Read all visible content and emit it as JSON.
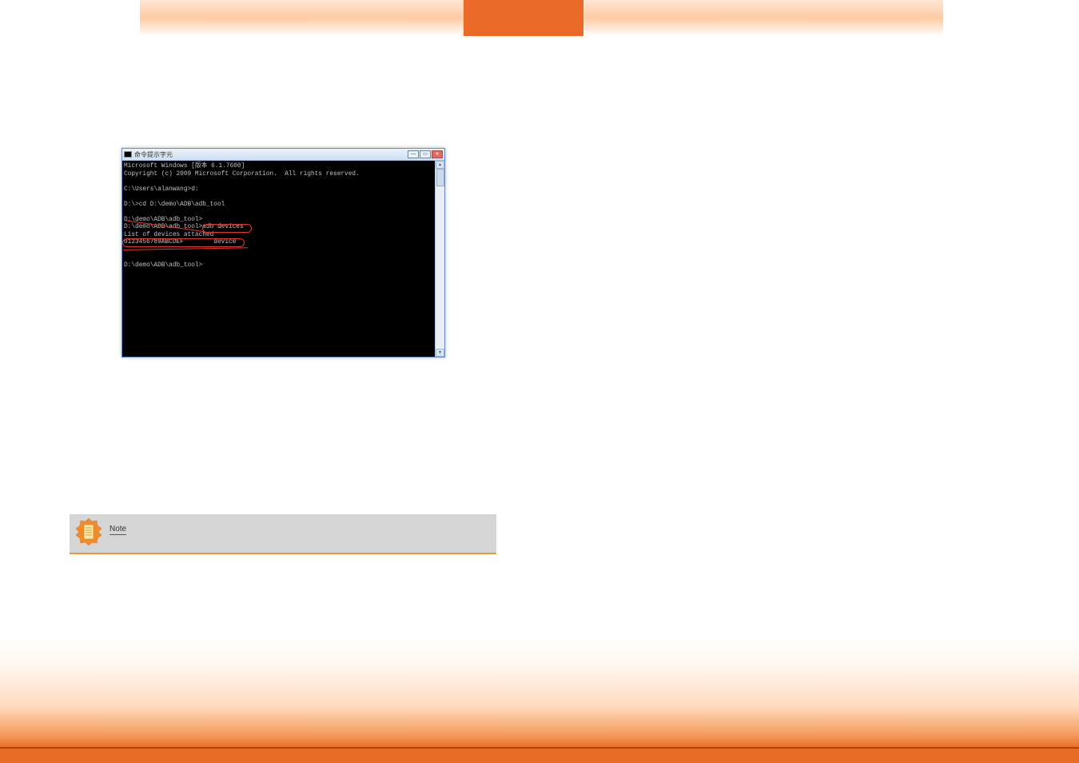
{
  "cmd": {
    "title": "命令提示字元",
    "lines": {
      "l1": "Microsoft Windows [版本 6.1.7600]",
      "l2": "Copyright (c) 2009 Microsoft Corporation.  All rights reserved.",
      "l3": "",
      "l4": "C:\\Users\\alanwang>d:",
      "l5": "",
      "l6": "D:\\>cd D:\\demo\\ADB\\adb_tool",
      "l7": "",
      "l8": "D:\\demo\\ADB\\adb_tool>",
      "l9a": "D:\\demo\\ADB\\adb_tool>",
      "l9b": "adb devices",
      "l10": "List of devices attached",
      "l11a": "0123456789ABCDEF",
      "l11b": "        device",
      "l12": "",
      "l13": "",
      "l14": "D:\\demo\\ADB\\adb_tool>"
    },
    "btn_min": "—",
    "btn_max": "▭",
    "btn_close": "✕",
    "scroll_up": "▴",
    "scroll_down": "▾"
  },
  "note": {
    "label": "Note"
  }
}
